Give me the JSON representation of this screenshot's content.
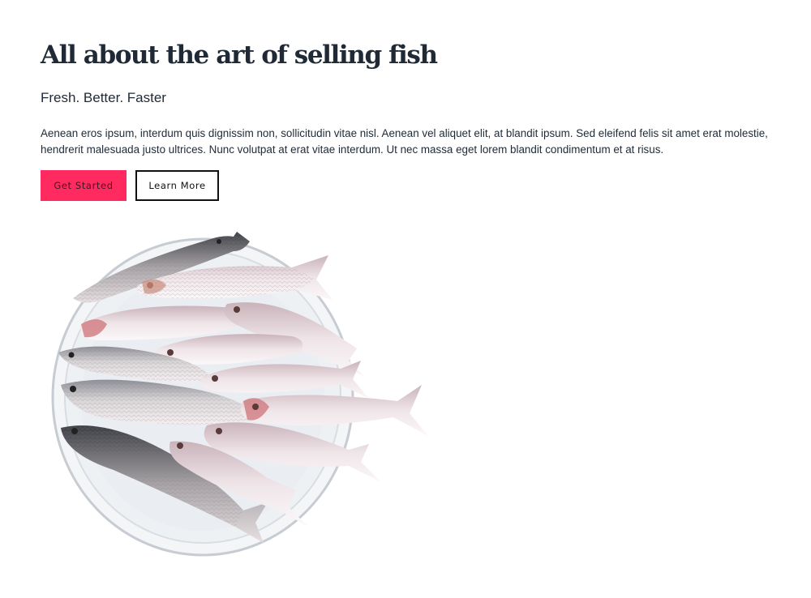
{
  "hero": {
    "title": "All about the art of selling fish",
    "subtitle": "Fresh. Better. Faster",
    "paragraph": "Aenean eros ipsum, interdum quis dignissim non, sollicitudin vitae nisl. Aenean vel aliquet elit, at blandit ipsum. Sed eleifend felis sit amet erat molestie, hendrerit malesuada justo ultrices. Nunc volutpat at erat vitae interdum. Ut nec massa eget lorem blandit condimentum et at risus.",
    "primary_button": "Get Started",
    "secondary_button": "Learn More"
  },
  "image": {
    "subject": "plate-of-fish"
  },
  "colors": {
    "text": "#1f2a36",
    "accent": "#ff2a5f",
    "outline": "#111111",
    "background": "#ffffff"
  }
}
